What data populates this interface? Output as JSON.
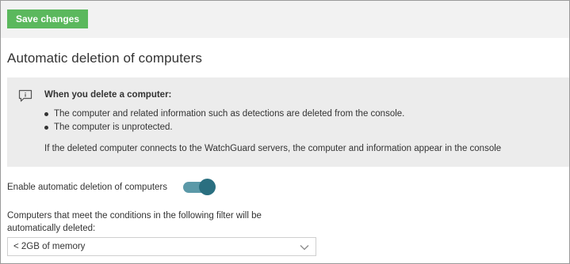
{
  "toolbar": {
    "save_label": "Save changes"
  },
  "page": {
    "title": "Automatic deletion of computers"
  },
  "info": {
    "icon": "comment-info-icon",
    "heading": "When you delete a computer:",
    "bullets": [
      "The computer and related information such as detections are deleted from the console.",
      "The computer is unprotected."
    ],
    "note": "If the deleted computer connects to the WatchGuard servers, the computer and information appear in the console"
  },
  "settings": {
    "enable_label": "Enable automatic deletion of computers",
    "enabled": true,
    "filter_description": "Computers that meet the conditions in the following filter will be automatically deleted:",
    "filter_selected": "< 2GB of memory"
  },
  "colors": {
    "save_button": "#5bb85d",
    "toggle_track": "#5b99a8",
    "toggle_knob": "#2a6f80",
    "info_background": "#ececec"
  }
}
